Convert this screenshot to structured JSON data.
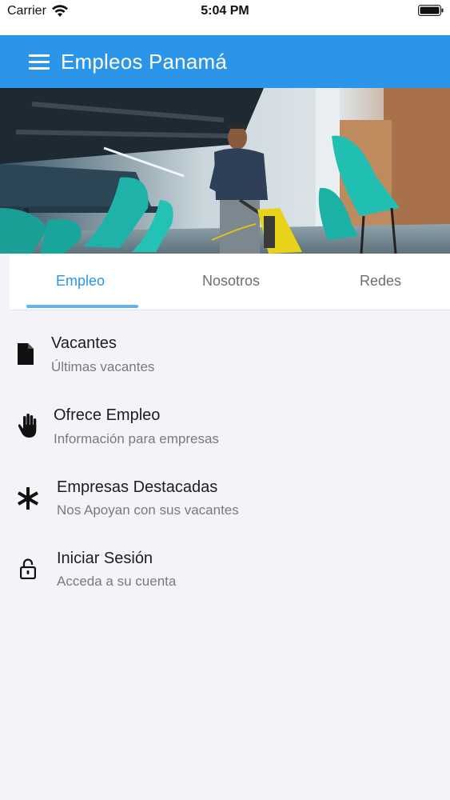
{
  "status_bar": {
    "carrier": "Carrier",
    "time": "5:04 PM",
    "wifi_icon": "wifi-icon",
    "battery_icon": "battery-icon"
  },
  "app_bar": {
    "title": "Empleos Panamá",
    "menu_icon": "hamburger-menu-icon",
    "background": "#2b95ea"
  },
  "tabs": [
    {
      "label": "Empleo",
      "active": true
    },
    {
      "label": "Nosotros",
      "active": false
    },
    {
      "label": "Redes",
      "active": false
    }
  ],
  "accent_color": "#2b95ea",
  "menu_items": [
    {
      "title": "Vacantes",
      "subtitle": "Últimas vacantes",
      "icon": "document-icon"
    },
    {
      "title": "Ofrece Empleo",
      "subtitle": "Información para empresas",
      "icon": "hand-icon"
    },
    {
      "title": "Empresas Destacadas",
      "subtitle": "Nos Apoyan con sus vacantes",
      "icon": "asterisk-icon"
    },
    {
      "title": "Iniciar Sesión",
      "subtitle": "Acceda a su cuenta",
      "icon": "unlock-icon"
    }
  ]
}
